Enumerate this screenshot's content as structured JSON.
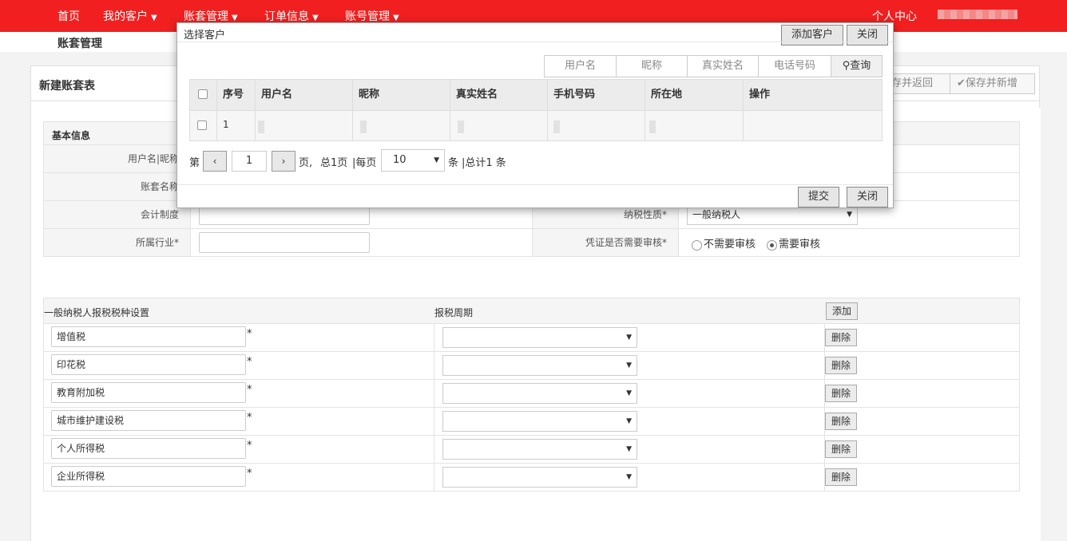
{
  "nav": {
    "home": "首页",
    "my_customers": "我的客户",
    "account_set_mgmt": "账套管理",
    "order_info": "订单信息",
    "account_mgmt": "账号管理",
    "personal_center": "个人中心",
    "caret": "▼"
  },
  "page": {
    "section_title": "账套管理",
    "panel_title": "新建账套表",
    "save_return": "存并返回",
    "save_new": "保存并新增"
  },
  "basic_info": {
    "heading": "基本信息",
    "username_label": "用户名|昵称",
    "account_name_label": "账套名称",
    "accounting_system_label": "会计制度",
    "industry_label": "所属行业*",
    "tax_nature_label": "纳税性质*",
    "tax_nature_value": "一般纳税人",
    "voucher_review_label": "凭证是否需要审核*",
    "no_review": "不需要审核",
    "need_review": "需要审核"
  },
  "tax_settings": {
    "heading": "一般纳税人报税税种设置",
    "period_heading": "报税周期",
    "add_button": "添加",
    "delete_button": "删除",
    "required_mark": "*",
    "rows": [
      {
        "tax": "增值税"
      },
      {
        "tax": "印花税"
      },
      {
        "tax": "教育附加税"
      },
      {
        "tax": "城市维护建设税"
      },
      {
        "tax": "个人所得税"
      },
      {
        "tax": "企业所得税"
      }
    ]
  },
  "modal": {
    "title": "选择客户",
    "add_customer": "添加客户",
    "close": "关闭",
    "search": {
      "username": "用户名",
      "nickname": "昵称",
      "real_name": "真实姓名",
      "phone": "电话号码",
      "query": "查询"
    },
    "columns": [
      "序号",
      "用户名",
      "昵称",
      "真实姓名",
      "手机号码",
      "所在地",
      "操作"
    ],
    "rows": [
      {
        "index": "1"
      }
    ],
    "pager": {
      "page_prefix": "第",
      "prev": "‹",
      "current": "1",
      "next": "›",
      "page_suffix": "页,",
      "total_pages": "总1页",
      "per_page_label": "|每页",
      "per_page": "10",
      "items_suffix": "条",
      "total": "|总计1 条"
    },
    "submit": "提交",
    "close_bottom": "关闭"
  }
}
